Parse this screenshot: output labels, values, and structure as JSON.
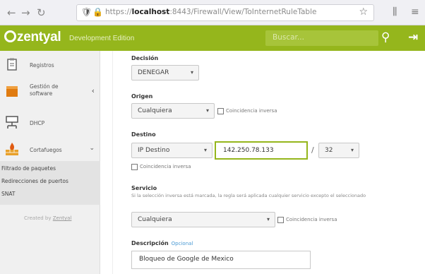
{
  "browser": {
    "url_prefix": "https://",
    "url_host": "localhost",
    "url_rest": ":8443/Firewall/View/ToInternetRuleTable"
  },
  "header": {
    "logo": "zentyal",
    "edition": "Development Edition",
    "search_placeholder": "Buscar...",
    "brand_color": "#95b61c"
  },
  "sidebar": {
    "items": [
      {
        "label": "Registros",
        "icon": "clipboard-icon"
      },
      {
        "label": "Gestión de software",
        "icon": "box-icon"
      },
      {
        "label": "DHCP",
        "icon": "network-icon"
      },
      {
        "label": "Cortafuegos",
        "icon": "firewall-icon"
      }
    ],
    "subitems": [
      "Filtrado de paquetes",
      "Redirecciones de puertos",
      "SNAT"
    ],
    "footer_prefix": "Created by",
    "footer_link": "Zentyal"
  },
  "form": {
    "decision": {
      "label": "Decisión",
      "value": "DENEGAR"
    },
    "origen": {
      "label": "Origen",
      "value": "Cualquiera",
      "inverse_label": "Coincidencia inversa"
    },
    "destino": {
      "label": "Destino",
      "type_value": "IP Destino",
      "ip_value": "142.250.78.133",
      "mask_value": "32",
      "inverse_label": "Coincidencia inversa"
    },
    "servicio": {
      "label": "Servicio",
      "note": "Si la selección inversa está marcada, la regla será aplicada cualquier servicio excepto el seleccionado",
      "value": "Cualquiera",
      "inverse_label": "Coincidencia inversa"
    },
    "descripcion": {
      "label": "Descripción",
      "optional": "Opcional",
      "value": "Bloqueo de Google de Mexico"
    }
  }
}
